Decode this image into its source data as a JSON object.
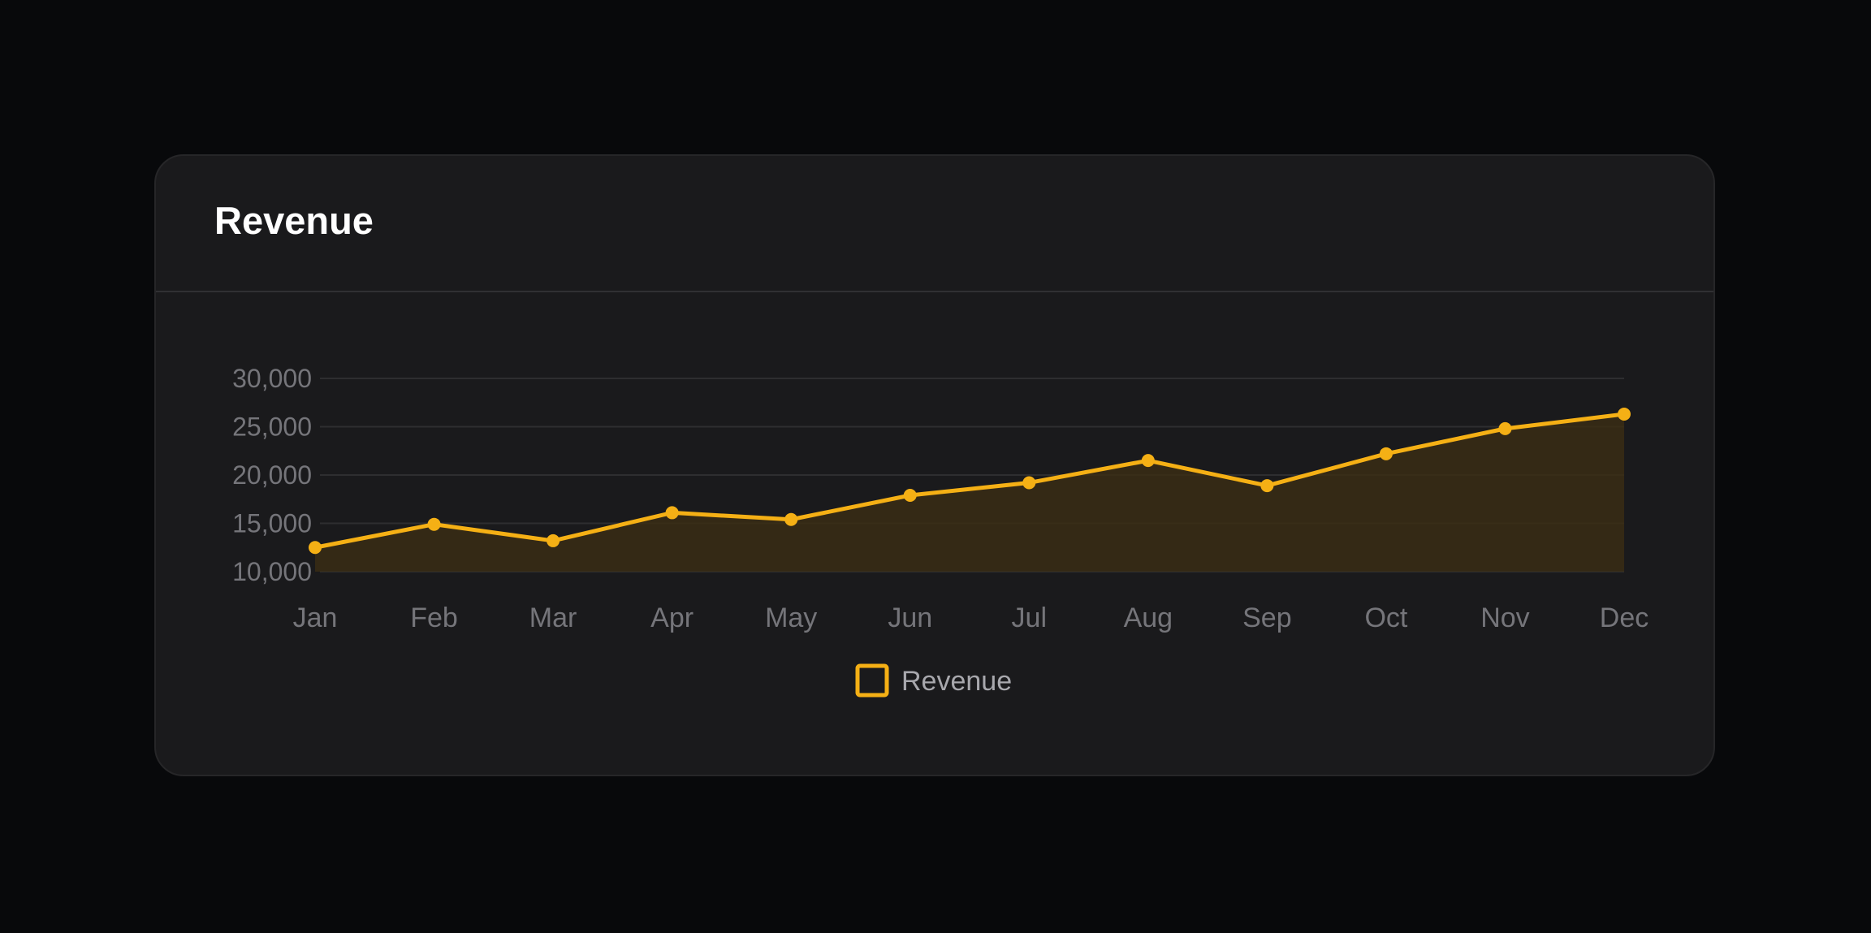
{
  "card": {
    "title": "Revenue"
  },
  "colors": {
    "page_background": "#08090b",
    "card_background": "#1a1a1c",
    "line": "#f5b015",
    "area_fill": "#3a2d14",
    "gridline": "#2e2e30",
    "tick_text": "#75757a"
  },
  "chart_data": {
    "type": "area",
    "categories": [
      "Jan",
      "Feb",
      "Mar",
      "Apr",
      "May",
      "Jun",
      "Jul",
      "Aug",
      "Sep",
      "Oct",
      "Nov",
      "Dec"
    ],
    "series": [
      {
        "name": "Revenue",
        "values": [
          12500,
          14900,
          13200,
          16100,
          15400,
          17900,
          19200,
          21500,
          18900,
          22200,
          24800,
          26300
        ]
      }
    ],
    "y_ticks": [
      "10,000",
      "15,000",
      "20,000",
      "25,000",
      "30,000"
    ],
    "ylim": [
      10000,
      30000
    ],
    "grid": true,
    "markers": true,
    "legend": {
      "position": "bottom-center",
      "label": "Revenue"
    }
  }
}
